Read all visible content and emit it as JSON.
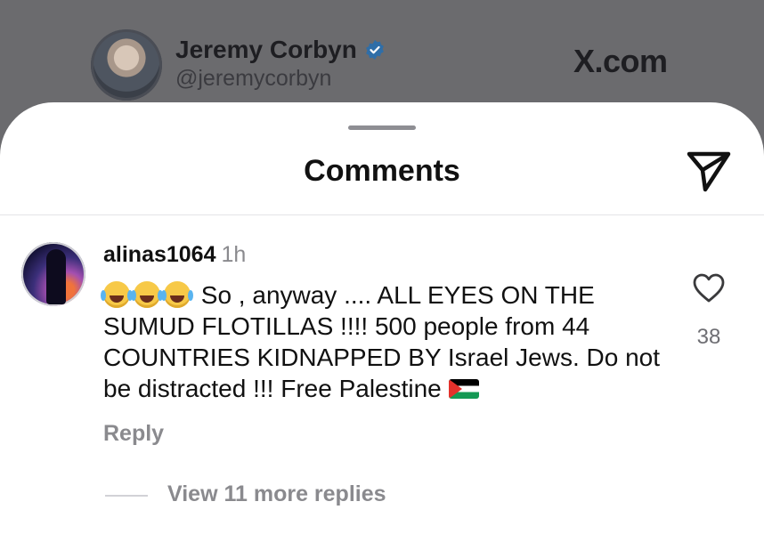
{
  "background_post": {
    "author_name": "Jeremy Corbyn",
    "author_handle": "@jeremycorbyn",
    "site_label": "X.com",
    "verified_icon": "verified-badge-icon"
  },
  "sheet": {
    "title": "Comments",
    "send_icon": "send-icon"
  },
  "comment": {
    "username": "alinas1064",
    "time": "1h",
    "text_prefix": "So , anyway .... ALL EYES ON THE SUMUD FLOTILLAS !!!! 500 people from 44 COUNTRIES KIDNAPPED BY Israel Jews. Do not be distracted !!! Free Palestine",
    "emojis": [
      "face-with-tears-of-joy",
      "face-with-tears-of-joy",
      "face-with-tears-of-joy"
    ],
    "flag": "palestine-flag",
    "like_count": "38",
    "reply_label": "Reply",
    "view_replies_label": "View 11 more replies"
  },
  "colors": {
    "accent_verified": "#1d9bf0",
    "muted_text": "#8a8a8e",
    "overlay": "#6b6b6e"
  }
}
